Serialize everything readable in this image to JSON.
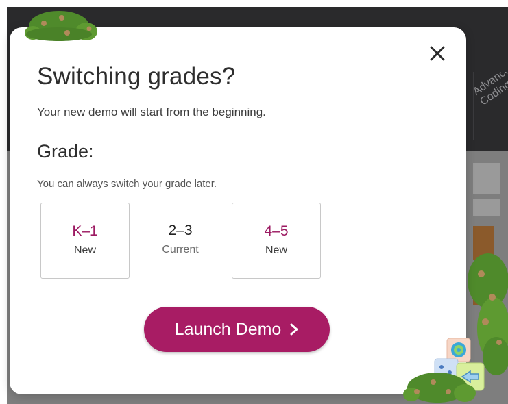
{
  "background": {
    "tile_text": [
      "Advanced",
      "Coding"
    ]
  },
  "modal": {
    "title": "Switching grades?",
    "subtitle": "Your new demo will start from the beginning.",
    "grade_heading": "Grade:",
    "grade_hint": "You can always switch your grade later.",
    "close_icon": "close-icon",
    "grades": [
      {
        "label": "K–1",
        "status": "New",
        "selectable": true
      },
      {
        "label": "2–3",
        "status": "Current",
        "selectable": false
      },
      {
        "label": "4–5",
        "status": "New",
        "selectable": true
      }
    ],
    "launch_label": "Launch Demo",
    "launch_icon": "chevron-right-icon"
  },
  "colors": {
    "accent": "#a81c64",
    "grade_new_text": "#9c1a62",
    "backdrop_dark": "#2a2a2c",
    "backdrop_grey": "#7e7e7e",
    "bush_green": "#4f8a2b",
    "bush_spots": "#b08a5a"
  }
}
